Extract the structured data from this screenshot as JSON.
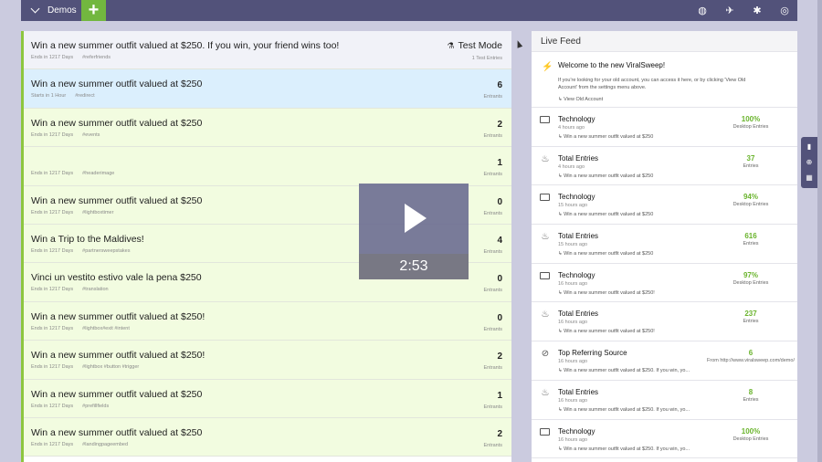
{
  "topbar": {
    "menu_label": "Demos",
    "add_label": "+",
    "icons": [
      "globe-icon",
      "rocket-icon",
      "gear-icon",
      "help-icon"
    ]
  },
  "campaigns": [
    {
      "title": "Win a new summer outfit valued at $250. If you win, your friend wins too!",
      "status": "Ends in 1217 Days",
      "tag": "#referfriends",
      "value": "Test Mode",
      "label": "1 Test Entries",
      "style": "first"
    },
    {
      "title": "Win a new summer outfit valued at $250",
      "status": "Starts in 1 Hour",
      "tag": "#redirect",
      "value": "6",
      "label": "Entrants",
      "style": "blue"
    },
    {
      "title": "Win a new summer outfit valued at $250",
      "status": "Ends in 1217 Days",
      "tag": "#events",
      "value": "2",
      "label": "Entrants",
      "style": ""
    },
    {
      "title": "",
      "status": "Ends in 1217 Days",
      "tag": "#headerimage",
      "value": "1",
      "label": "Entrants",
      "style": ""
    },
    {
      "title": "Win a new summer outfit valued at $250",
      "status": "Ends in 1217 Days",
      "tag": "#lightboxtimer",
      "value": "0",
      "label": "Entrants",
      "style": ""
    },
    {
      "title": "Win a Trip to the Maldives!",
      "status": "Ends in 1217 Days",
      "tag": "#partnersweepstakes",
      "value": "4",
      "label": "Entrants",
      "style": ""
    },
    {
      "title": "Vinci un vestito estivo vale la pena $250",
      "status": "Ends in 1217 Days",
      "tag": "#translation",
      "value": "0",
      "label": "Entrants",
      "style": ""
    },
    {
      "title": "Win a new summer outfit valued at $250!",
      "status": "Ends in 1217 Days",
      "tag": "#lightbox#exit #intent",
      "value": "0",
      "label": "Entrants",
      "style": ""
    },
    {
      "title": "Win a new summer outfit valued at $250!",
      "status": "Ends in 1217 Days",
      "tag": "#lightbox #button #trigger",
      "value": "2",
      "label": "Entrants",
      "style": ""
    },
    {
      "title": "Win a new summer outfit valued at $250",
      "status": "Ends in 1217 Days",
      "tag": "#prefillfields",
      "value": "1",
      "label": "Entrants",
      "style": ""
    },
    {
      "title": "Win a new summer outfit valued at $250",
      "status": "Ends in 1217 Days",
      "tag": "#landingpageembed",
      "value": "2",
      "label": "Entrants",
      "style": ""
    }
  ],
  "video": {
    "duration": "2:53"
  },
  "feed": {
    "title": "Live Feed",
    "welcome": {
      "title": "Welcome to the new ViralSweep!",
      "body": "If you're looking for your old account, you can access it here, or by clicking 'View Old Account' from the settings menu above.",
      "link": "↳ View Old Account"
    },
    "items": [
      {
        "icon": "monitor",
        "title": "Technology",
        "time": "4 hours ago",
        "sub": "↳ Win a new summer outfit valued at $250",
        "value": "100%",
        "label": "Desktop Entries"
      },
      {
        "icon": "fire",
        "title": "Total Entries",
        "time": "4 hours ago",
        "sub": "↳ Win a new summer outfit valued at $250",
        "value": "37",
        "label": "Entries"
      },
      {
        "icon": "monitor",
        "title": "Technology",
        "time": "15 hours ago",
        "sub": "↳ Win a new summer outfit valued at $250",
        "value": "94%",
        "label": "Desktop Entries"
      },
      {
        "icon": "fire",
        "title": "Total Entries",
        "time": "15 hours ago",
        "sub": "↳ Win a new summer outfit valued at $250",
        "value": "616",
        "label": "Entries"
      },
      {
        "icon": "monitor",
        "title": "Technology",
        "time": "16 hours ago",
        "sub": "↳ Win a new summer outfit valued at $250!",
        "value": "97%",
        "label": "Desktop Entries"
      },
      {
        "icon": "fire",
        "title": "Total Entries",
        "time": "16 hours ago",
        "sub": "↳ Win a new summer outfit valued at $250!",
        "value": "237",
        "label": "Entries"
      },
      {
        "icon": "link",
        "title": "Top Referring Source",
        "time": "16 hours ago",
        "sub": "↳ Win a new summer outfit valued at $250. If you win, yo...",
        "value": "6",
        "label": "From http://www.viralsweep.com/demo/"
      },
      {
        "icon": "fire",
        "title": "Total Entries",
        "time": "16 hours ago",
        "sub": "↳ Win a new summer outfit valued at $250. If you win, yo...",
        "value": "8",
        "label": "Entries"
      },
      {
        "icon": "monitor",
        "title": "Technology",
        "time": "16 hours ago",
        "sub": "↳ Win a new summer outfit valued at $250. If you win, yo...",
        "value": "100%",
        "label": "Desktop Entries"
      }
    ]
  },
  "rail_icons": [
    "book-icon",
    "lifebuoy-icon",
    "calendar-icon"
  ]
}
